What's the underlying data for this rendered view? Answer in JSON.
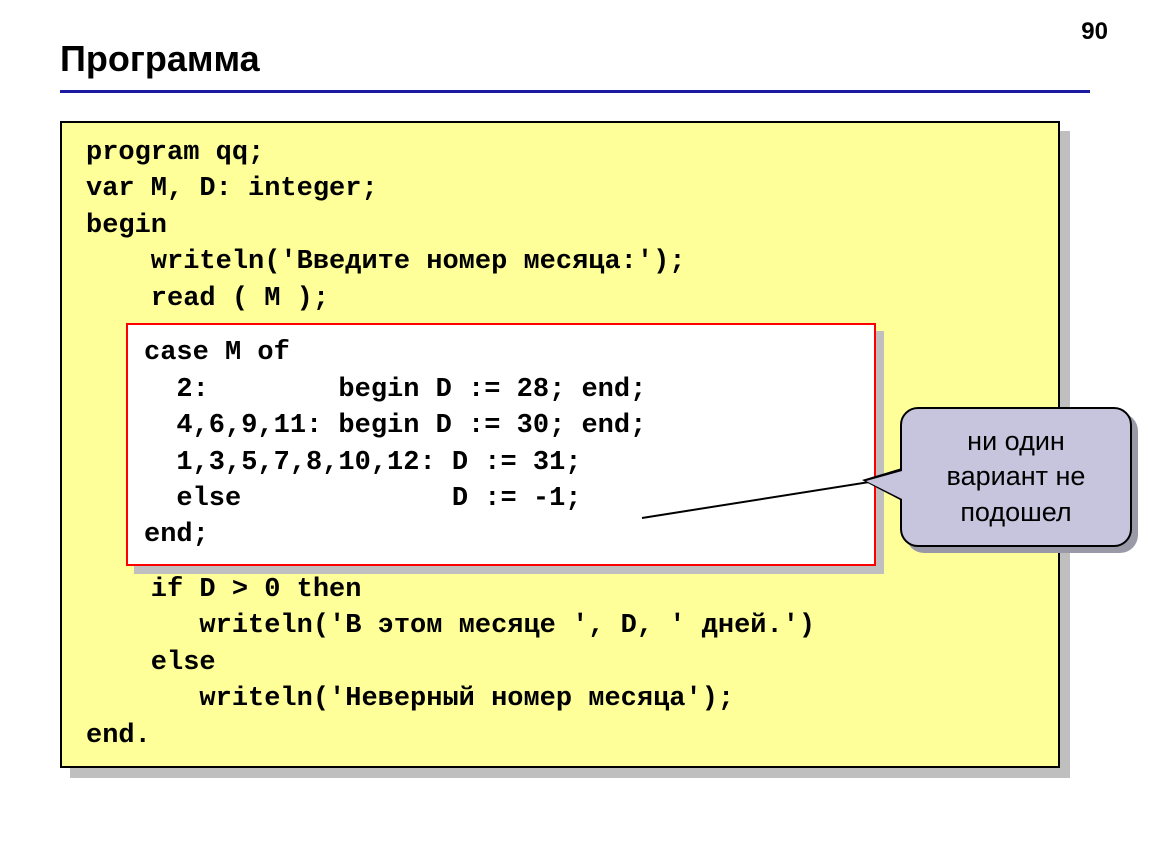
{
  "pageNumber": "90",
  "title": "Программа",
  "code": {
    "l1": "program qq;",
    "l2": "var M, D: integer;",
    "l3": "begin",
    "l4": "    writeln('Введите номер месяца:');",
    "l5": "    read ( M );",
    "i1": "case M of",
    "i2": "  2:        begin D := 28; end;",
    "i3": "  4,6,9,11: begin D := 30; end;",
    "i4": "  1,3,5,7,8,10,12: D := 31;",
    "i5": "  else             D := -1;",
    "i6": "end;",
    "l6": "    if D > 0 then",
    "l7": "       writeln('В этом месяце ', D, ' дней.')",
    "l8": "    else",
    "l9": "       writeln('Неверный номер месяца');",
    "l10": "end."
  },
  "callout": "ни один вариант не подошел"
}
